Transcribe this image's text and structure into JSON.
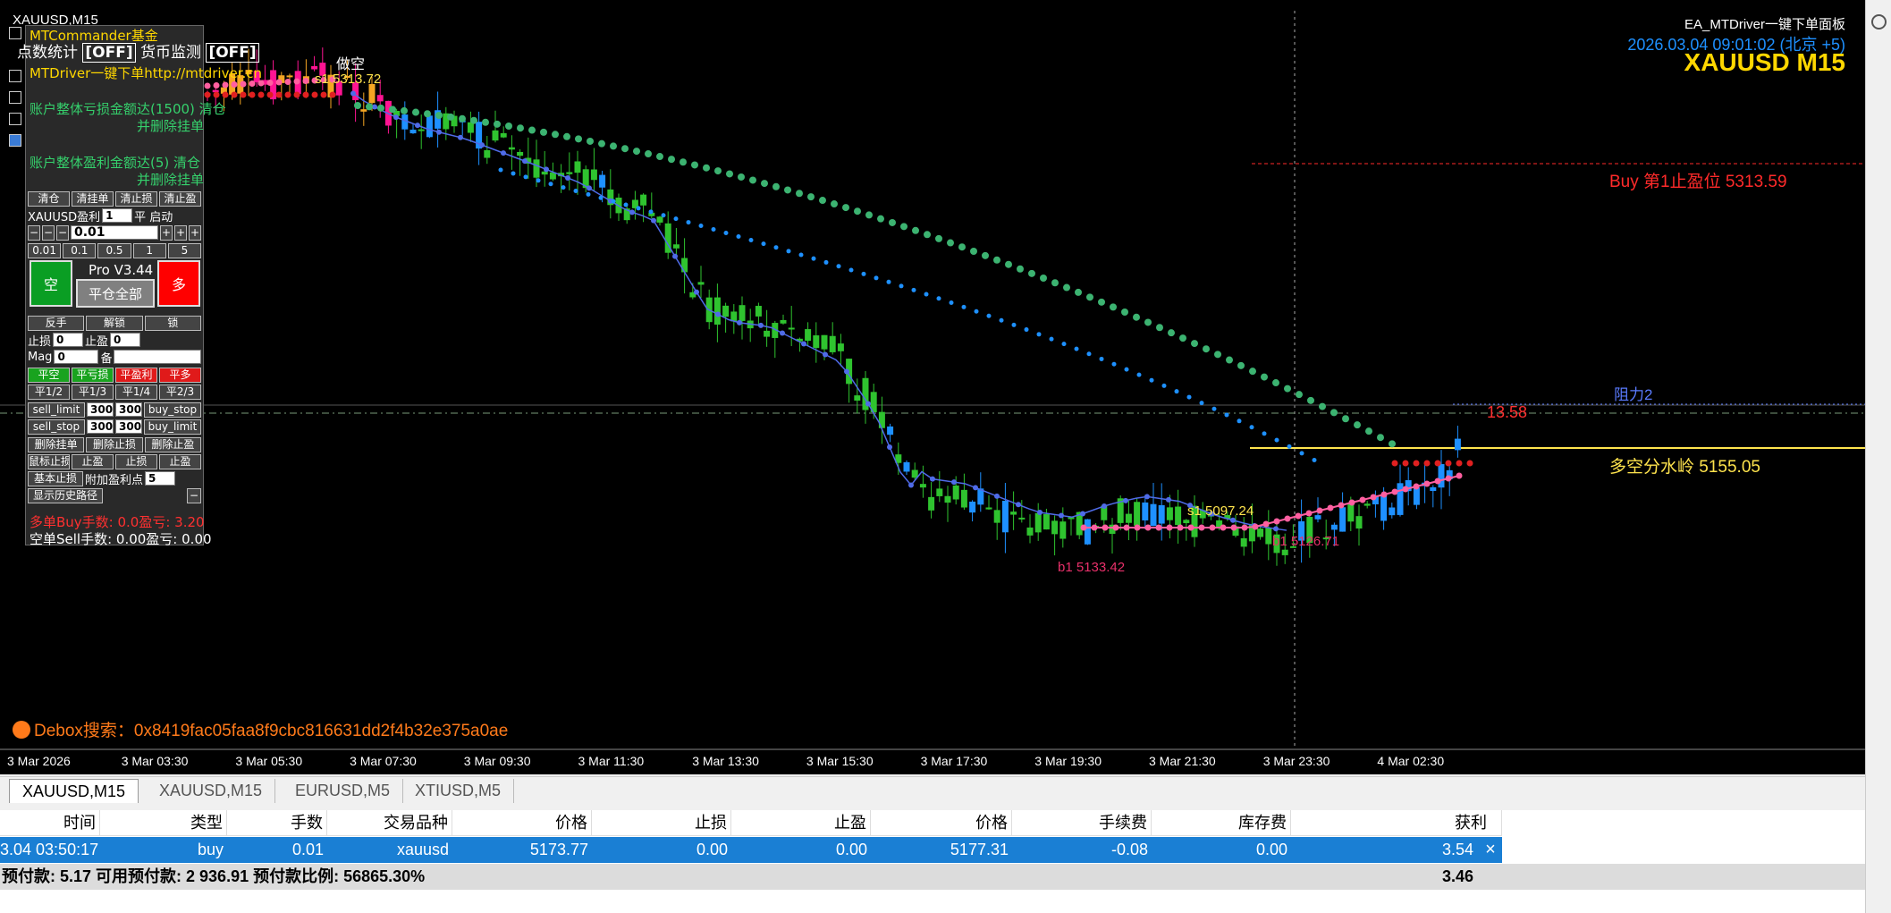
{
  "chart": {
    "symbol_small": "XAUUSD,M15",
    "ea_name": "EA_MTDriver一键下单面板",
    "datetime": "2026.03.04 09:01:02 (北京 +5)",
    "big_symbol": "XAUUSD M15",
    "tp_label": "Buy 第1止盈位 5313.59",
    "resist_label": "阻力2",
    "watershed_label": "多空分水岭 5155.05",
    "red_number": "13.58",
    "debox": "Debox搜索：0x8419fac05faa8f9cbc816631dd2f4b32e375a0ae",
    "short_label": "做空",
    "price_tags": [
      {
        "text": "s1 5313.72",
        "color": "#ffe44d"
      },
      {
        "text": "s1 5097.24",
        "color": "#ffe44d"
      },
      {
        "text": "b1 5133.42",
        "color": "#e8306a"
      },
      {
        "text": "b1 5126.71",
        "color": "#e8306a"
      }
    ],
    "x_ticks": [
      "3 Mar 2026",
      "3 Mar 03:30",
      "3 Mar 05:30",
      "3 Mar 07:30",
      "3 Mar 09:30",
      "3 Mar 11:30",
      "3 Mar 13:30",
      "3 Mar 15:30",
      "3 Mar 17:30",
      "3 Mar 19:30",
      "3 Mar 21:30",
      "3 Mar 23:30",
      "4 Mar 02:30"
    ],
    "colors": {
      "bull": "#2fc32f",
      "bear_early": "#f5a623",
      "bear": "#1e90ff",
      "ma": "#4f6be8",
      "green_dots": "#3cb371",
      "blue_dots": "#1e90ff",
      "pink": "#ff5fa0",
      "tp_line": "#ff2a2a",
      "watershed": "#ffe44d"
    }
  },
  "chart_data": {
    "type": "candlestick",
    "title": "XAUUSD M15",
    "x": [
      "3 Mar 2026",
      "3 Mar 03:30",
      "3 Mar 05:30",
      "3 Mar 07:30",
      "3 Mar 09:30",
      "3 Mar 11:30",
      "3 Mar 13:30",
      "3 Mar 15:30",
      "3 Mar 17:30",
      "3 Mar 19:30",
      "3 Mar 21:30",
      "3 Mar 23:30",
      "4 Mar 02:30"
    ],
    "levels": {
      "buy_take_profit_1": 5313.59,
      "watershed": 5155.05
    },
    "annotations": [
      "s1 5313.72",
      "s1 5097.24",
      "b1 5133.42",
      "b1 5126.71"
    ]
  },
  "panel": {
    "title": "MTCommander基金",
    "stats_text": "点数统计",
    "stats_off": "[OFF]",
    "monitor_text": "货币监测",
    "monitor_off": "[OFF]",
    "link": "MTDriver一键下单http://mtdriver.cn",
    "loss_line1": "账户整体亏损金额达(1500) 清仓",
    "loss_line2": "并删除挂单",
    "profit_line1": "账户整体盈利金额达(5) 清仓",
    "profit_line2": "并删除挂单",
    "row_a": [
      "清仓",
      "清挂单",
      "清止损",
      "清止盈"
    ],
    "symbol_label": "XAUUSD盈利",
    "symbol_value": "1",
    "move_label": "平 启动",
    "lot_minus": [
      "−",
      "−",
      "−"
    ],
    "lot_value": "0.01",
    "lot_plus": [
      "+",
      "+",
      "+"
    ],
    "lot_presets": [
      "0.01",
      "0.1",
      "0.5",
      "1",
      "5"
    ],
    "big_short": "空",
    "big_long": "多",
    "pro_version": "Pro V3.44",
    "close_all": "平仓全部",
    "row_b": [
      "反手",
      "解锁",
      "锁"
    ],
    "sl_label": "止损",
    "sl_value": "0",
    "tp_label": "止盈",
    "tp_value": "0",
    "magic_label": "Mag",
    "magic_value": "0",
    "note_label": "备",
    "row_c": [
      "平空",
      "平亏损",
      "平盈利",
      "平多"
    ],
    "row_d": [
      "平1/2",
      "平1/3",
      "平1/4",
      "平2/3"
    ],
    "sell_limit": "sell_limit",
    "sell_limit_val": "300",
    "buy_stop_val": "300",
    "buy_stop": "buy_stop",
    "sell_stop": "sell_stop",
    "sell_stop_val": "300",
    "buy_limit_val": "300",
    "buy_limit": "buy_limit",
    "row_e": [
      "删除挂单",
      "删除止损",
      "删除止盈"
    ],
    "row_f": [
      "鼠标止损",
      "止盈",
      "止损",
      "止盈"
    ],
    "row_g_label": "基本止损",
    "row_g_add": "附加盈利点",
    "row_g_value": "5",
    "history_label": "显示历史路径",
    "red_line": "多单Buy手数: 0.0盈亏: 3.20",
    "white_line": "空单Sell手数: 0.00盈亏: 0.00"
  },
  "tabs": [
    {
      "label": "XAUUSD,M15",
      "active": true
    },
    {
      "label": "XAUUSD,M15",
      "active": false
    },
    {
      "label": "EURUSD,M5",
      "active": false
    },
    {
      "label": "XTIUSD,M5",
      "active": false
    }
  ],
  "table": {
    "headers": [
      "时间",
      "类型",
      "手数",
      "交易品种",
      "价格",
      "止损",
      "止盈",
      "价格",
      "手续费",
      "库存费",
      "获利"
    ],
    "row": [
      "3.04 03:50:17",
      "buy",
      "0.01",
      "xauusd",
      "5173.77",
      "0.00",
      "0.00",
      "5177.31",
      "-0.08",
      "0.00",
      "3.54"
    ],
    "footer_text": "预付款: 5.17  可用预付款: 2 936.91  预付款比例: 56865.30%",
    "footer_total": "3.46",
    "close_icon": "×"
  }
}
